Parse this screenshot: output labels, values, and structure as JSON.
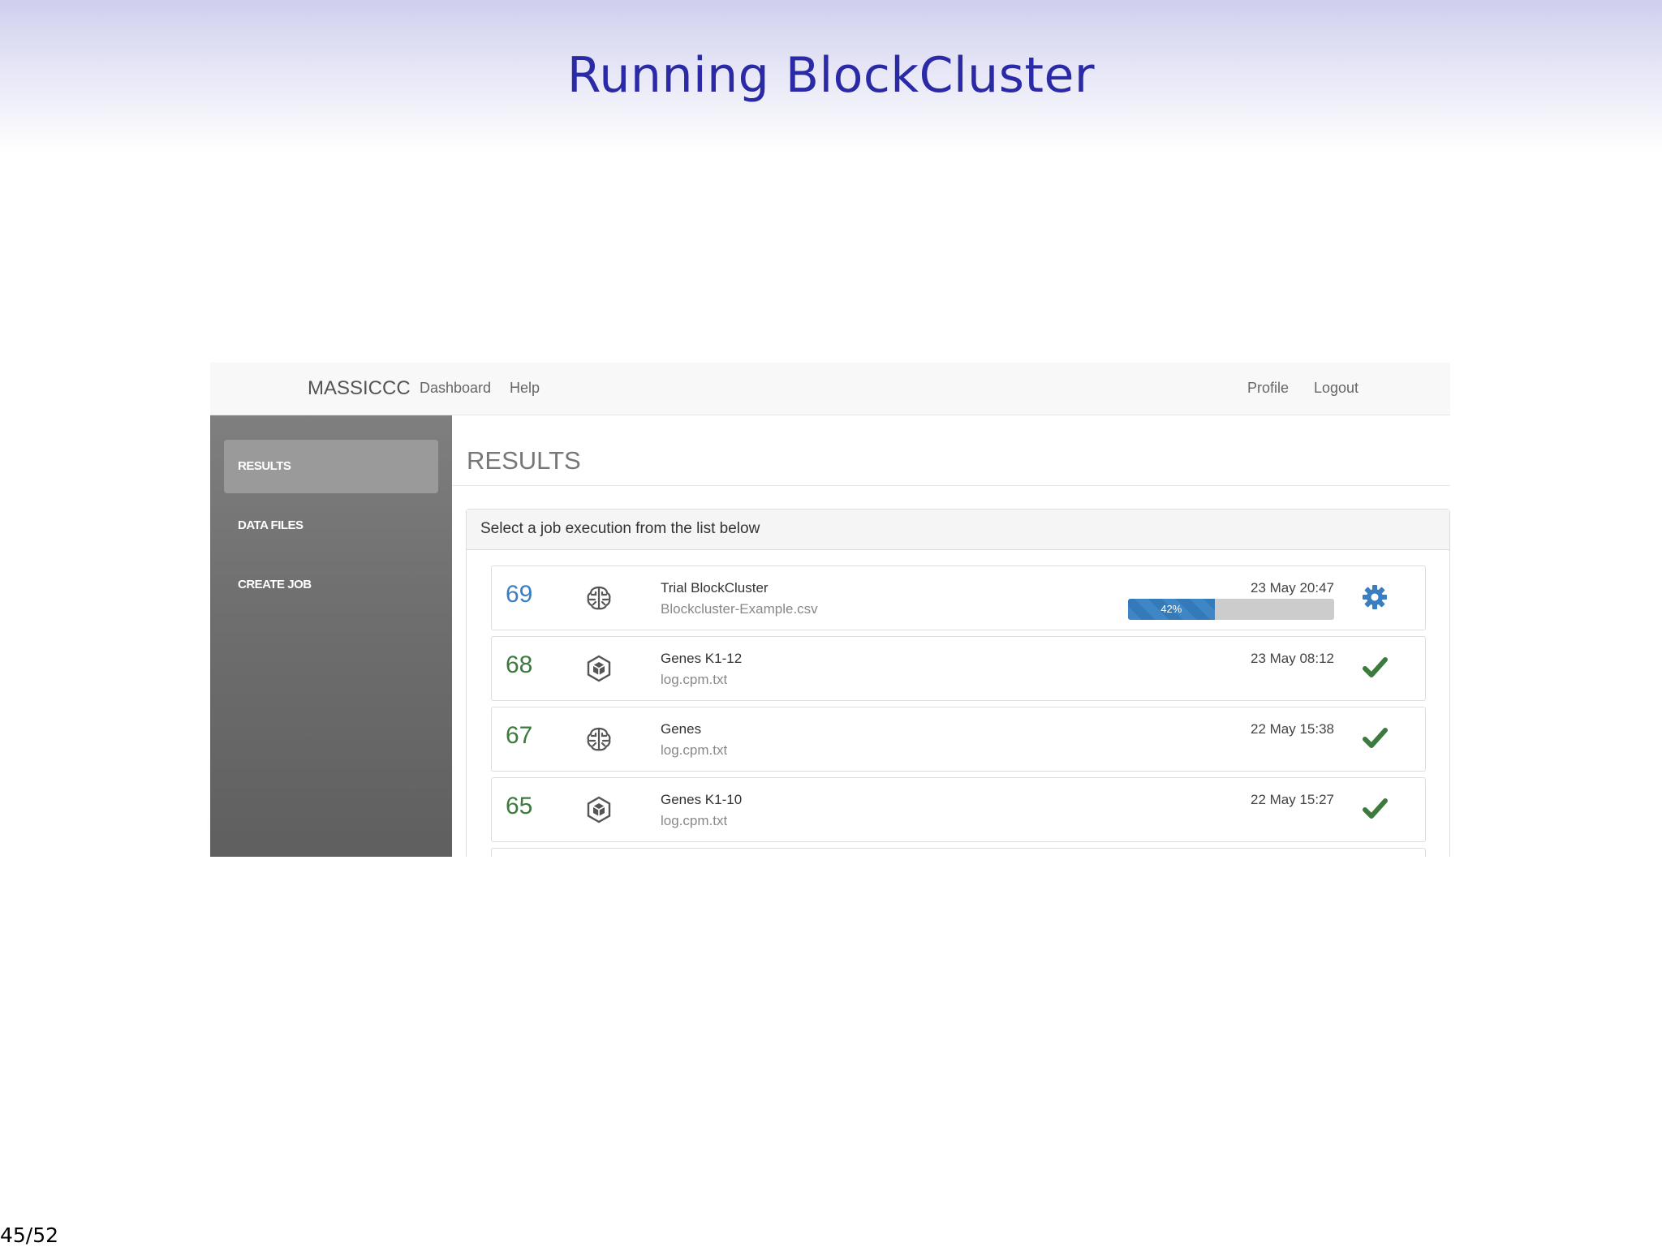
{
  "slide": {
    "title": "Running BlockCluster",
    "page_number": "45/52"
  },
  "app": {
    "brand": "MASSICCC",
    "nav": {
      "dashboard": "Dashboard",
      "help": "Help",
      "profile": "Profile",
      "logout": "Logout"
    },
    "sidebar": {
      "items": [
        {
          "label": "RESULTS",
          "active": true
        },
        {
          "label": "DATA FILES",
          "active": false
        },
        {
          "label": "CREATE JOB",
          "active": false
        }
      ]
    },
    "main": {
      "heading": "RESULTS",
      "panel_title": "Select a job execution from the list below",
      "jobs": [
        {
          "id": "69",
          "id_color": "#3a7ec0",
          "icon": "brain-icon",
          "name": "Trial BlockCluster",
          "file": "Blockcluster-Example.csv",
          "date": "23 May 20:47",
          "status": "running",
          "status_icon": "gear-icon",
          "progress": 0.42,
          "progress_label": "42%"
        },
        {
          "id": "68",
          "id_color": "#3d7a3d",
          "icon": "hexagon-cube-icon",
          "name": "Genes K1-12",
          "file": "log.cpm.txt",
          "date": "23 May 08:12",
          "status": "done",
          "status_icon": "check-icon"
        },
        {
          "id": "67",
          "id_color": "#3d7a3d",
          "icon": "brain-icon",
          "name": "Genes",
          "file": "log.cpm.txt",
          "date": "22 May 15:38",
          "status": "done",
          "status_icon": "check-icon"
        },
        {
          "id": "65",
          "id_color": "#3d7a3d",
          "icon": "hexagon-cube-icon",
          "name": "Genes K1-10",
          "file": "log.cpm.txt",
          "date": "22 May 15:27",
          "status": "done",
          "status_icon": "check-icon"
        }
      ]
    },
    "colors": {
      "title_blue": "#2a2aa6",
      "check_green": "#3d7a3d",
      "gear_blue": "#3a7ec0",
      "progress_blue": "#3f86c6"
    }
  }
}
